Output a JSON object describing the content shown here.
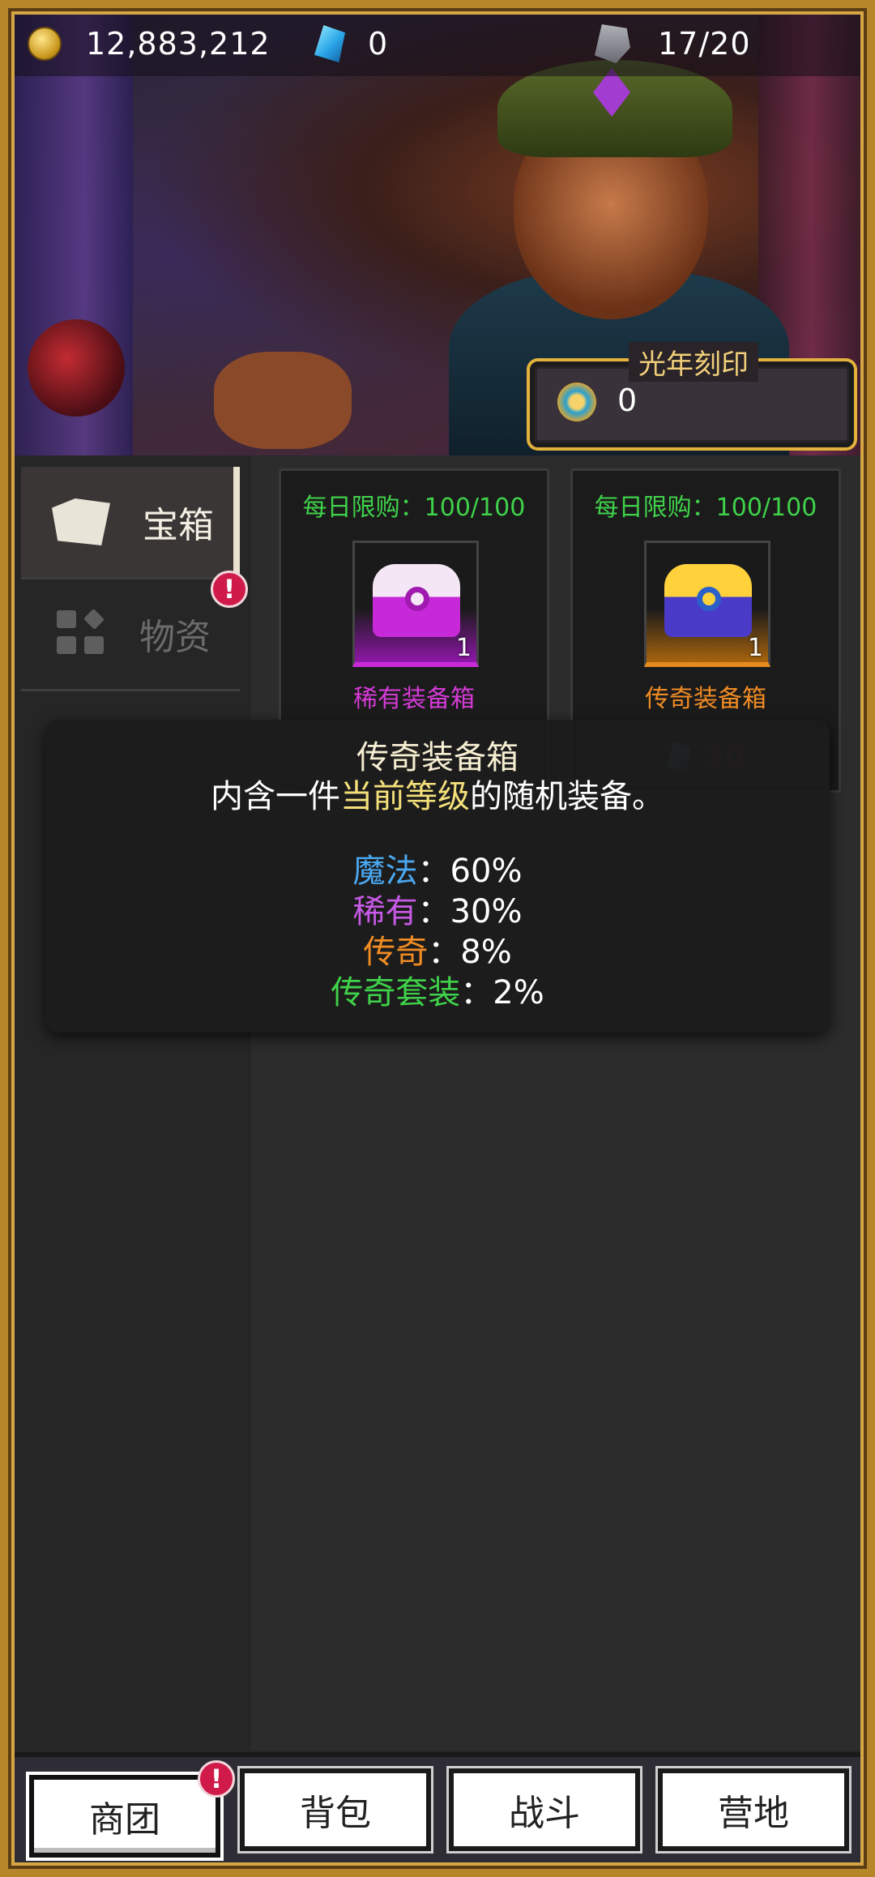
{
  "resources": {
    "gold": "12,883,212",
    "gems": "0",
    "stamina": "17/20"
  },
  "seal": {
    "title": "光年刻印",
    "value": "0"
  },
  "sidebar": {
    "tabs": [
      {
        "label": "宝箱",
        "active": true
      },
      {
        "label": "物资",
        "active": false
      }
    ],
    "alert": "!"
  },
  "shop": {
    "cards": [
      {
        "limit": "每日限购：100/100",
        "name": "稀有装备箱",
        "qty": "1",
        "price": "",
        "quality": "rare"
      },
      {
        "limit": "每日限购：100/100",
        "name": "传奇装备箱",
        "qty": "1",
        "price": "30",
        "quality": "legend"
      }
    ]
  },
  "tooltip": {
    "title": "传奇装备箱",
    "desc_pre": "内含一件",
    "desc_highlight": "当前等级",
    "desc_post": "的随机装备。",
    "rows": [
      {
        "label": "魔法",
        "sep": "：",
        "value": "60%"
      },
      {
        "label": "稀有",
        "sep": "：",
        "value": "30%"
      },
      {
        "label": "传奇",
        "sep": "：",
        "value": "8%"
      },
      {
        "label": "传奇套装",
        "sep": "：",
        "value": "2%"
      }
    ]
  },
  "nav": {
    "items": [
      "商团",
      "背包",
      "战斗",
      "营地"
    ],
    "alert": "!"
  },
  "colors": {
    "frame_gold": "#b8862a",
    "limit_green": "#3fd24a",
    "rare_purple": "#d43ad6",
    "legend_orange": "#f08c24",
    "magic_blue": "#4aa8f0",
    "alert_red": "#d01a4a"
  }
}
